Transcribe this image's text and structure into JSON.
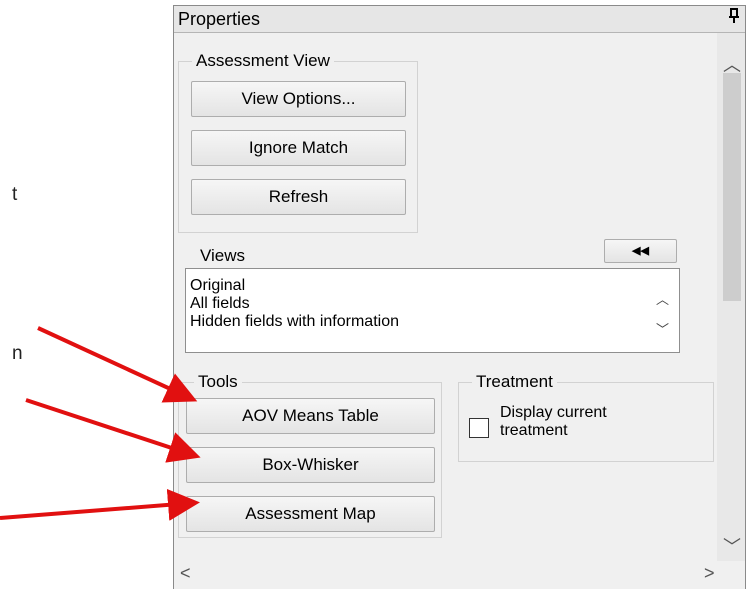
{
  "left_fragments": {
    "char1": "t",
    "char2": "n"
  },
  "panel": {
    "title": "Properties",
    "pin_icon": "pin-icon"
  },
  "assessment_view": {
    "label": "Assessment View",
    "buttons": [
      "View Options...",
      "Ignore Match",
      "Refresh"
    ]
  },
  "views": {
    "label": "Views",
    "collapse_button": "◀◀",
    "items": [
      "Original",
      "All fields",
      "Hidden fields with information"
    ]
  },
  "tools": {
    "label": "Tools",
    "buttons": [
      "AOV Means Table",
      "Box-Whisker",
      "Assessment Map"
    ]
  },
  "treatment": {
    "label": "Treatment",
    "checkbox_label": "Display current treatment",
    "checked": false
  },
  "annotation": {
    "arrow_color": "#e11010"
  }
}
